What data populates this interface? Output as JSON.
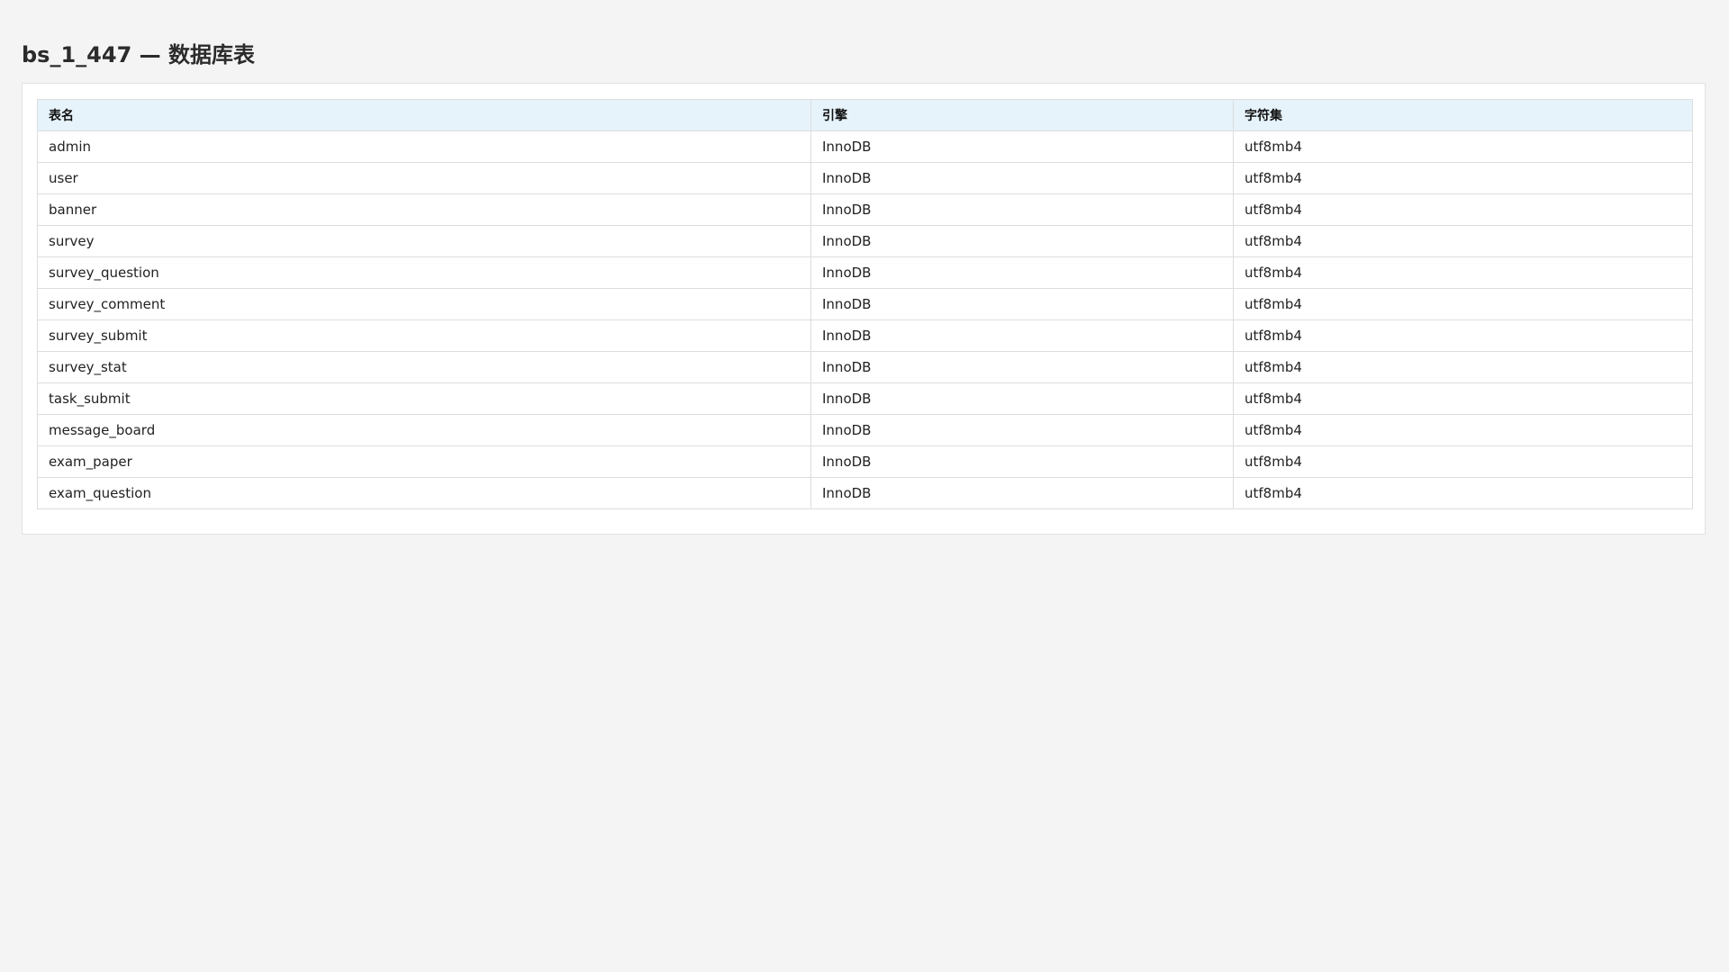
{
  "title": "bs_1_447 — 数据库表",
  "table": {
    "columns": [
      "表名",
      "引擎",
      "字符集"
    ],
    "rows": [
      [
        "admin",
        "InnoDB",
        "utf8mb4"
      ],
      [
        "user",
        "InnoDB",
        "utf8mb4"
      ],
      [
        "banner",
        "InnoDB",
        "utf8mb4"
      ],
      [
        "survey",
        "InnoDB",
        "utf8mb4"
      ],
      [
        "survey_question",
        "InnoDB",
        "utf8mb4"
      ],
      [
        "survey_comment",
        "InnoDB",
        "utf8mb4"
      ],
      [
        "survey_submit",
        "InnoDB",
        "utf8mb4"
      ],
      [
        "survey_stat",
        "InnoDB",
        "utf8mb4"
      ],
      [
        "task_submit",
        "InnoDB",
        "utf8mb4"
      ],
      [
        "message_board",
        "InnoDB",
        "utf8mb4"
      ],
      [
        "exam_paper",
        "InnoDB",
        "utf8mb4"
      ],
      [
        "exam_question",
        "InnoDB",
        "utf8mb4"
      ]
    ]
  },
  "colors": {
    "page_background": "#f4f4f4",
    "header_background": "#e6f3fb",
    "border": "#dddddd"
  }
}
